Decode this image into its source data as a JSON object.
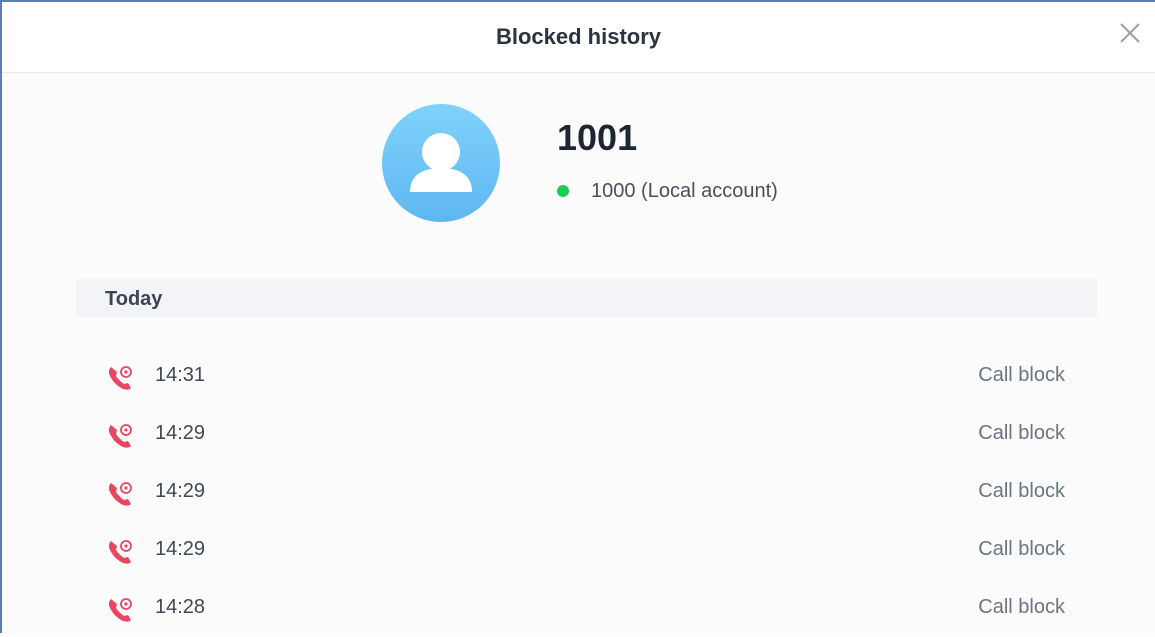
{
  "dialog": {
    "title": "Blocked history"
  },
  "contact": {
    "name": "1001",
    "account": "1000 (Local account)",
    "status_color": "#1ecc4f",
    "avatar_icon": "person-icon"
  },
  "history": {
    "group_label": "Today",
    "entries": [
      {
        "time": "14:31",
        "type": "Call block",
        "icon": "blocked-call-icon"
      },
      {
        "time": "14:29",
        "type": "Call block",
        "icon": "blocked-call-icon"
      },
      {
        "time": "14:29",
        "type": "Call block",
        "icon": "blocked-call-icon"
      },
      {
        "time": "14:29",
        "type": "Call block",
        "icon": "blocked-call-icon"
      },
      {
        "time": "14:28",
        "type": "Call block",
        "icon": "blocked-call-icon"
      }
    ]
  },
  "colors": {
    "blocked_icon": "#e8475f",
    "accent_border": "#5b7fb2"
  }
}
